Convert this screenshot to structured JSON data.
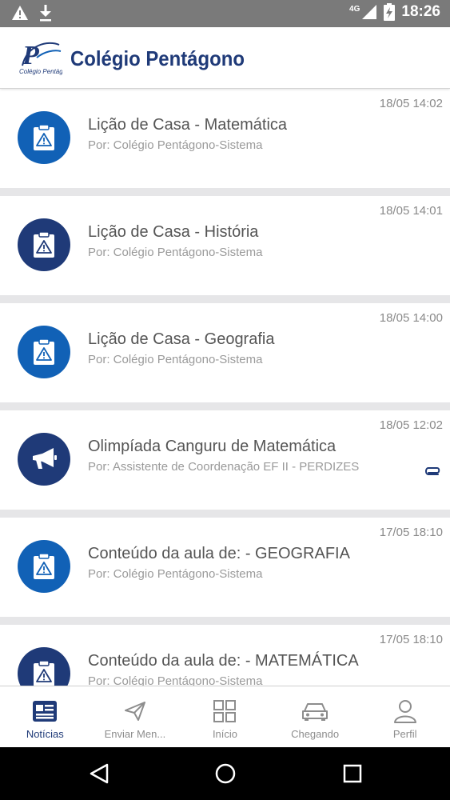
{
  "status_bar": {
    "network": "4G",
    "time": "18:26"
  },
  "app": {
    "title": "Colégio Pentágono",
    "logo_text": "Colégio Pentágono"
  },
  "colors": {
    "brand_navy": "#1f3a78",
    "brand_blue": "#1161b6"
  },
  "feed": [
    {
      "date": "18/05 14:02",
      "title": "Lição de Casa - Matemática",
      "author": "Por: Colégio Pentágono-Sistema",
      "icon": "clipboard-warning-icon",
      "color": "blue",
      "attachment": false
    },
    {
      "date": "18/05 14:01",
      "title": "Lição de Casa - História",
      "author": "Por: Colégio Pentágono-Sistema",
      "icon": "clipboard-warning-icon",
      "color": "navy",
      "attachment": false
    },
    {
      "date": "18/05 14:00",
      "title": "Lição de Casa - Geografia",
      "author": "Por: Colégio Pentágono-Sistema",
      "icon": "clipboard-warning-icon",
      "color": "blue",
      "attachment": false
    },
    {
      "date": "18/05 12:02",
      "title": "Olimpíada Canguru de Matemática",
      "author": "Por: Assistente de Coordenação EF II - PERDIZES",
      "icon": "megaphone-icon",
      "color": "navy",
      "attachment": true
    },
    {
      "date": "17/05 18:10",
      "title": "Conteúdo da aula de: - GEOGRAFIA",
      "author": "Por: Colégio Pentágono-Sistema",
      "icon": "clipboard-warning-icon",
      "color": "blue",
      "attachment": false
    },
    {
      "date": "17/05 18:10",
      "title": "Conteúdo da aula de: - MATEMÁTICA",
      "author": "Por: Colégio Pentágono-Sistema",
      "icon": "clipboard-warning-icon",
      "color": "navy",
      "attachment": false
    }
  ],
  "bottom_nav": [
    {
      "label": "Notícias",
      "icon": "news-icon",
      "active": true
    },
    {
      "label": "Enviar Men...",
      "icon": "send-icon",
      "active": false
    },
    {
      "label": "Início",
      "icon": "grid-icon",
      "active": false
    },
    {
      "label": "Chegando",
      "icon": "car-icon",
      "active": false
    },
    {
      "label": "Perfil",
      "icon": "person-icon",
      "active": false
    }
  ]
}
